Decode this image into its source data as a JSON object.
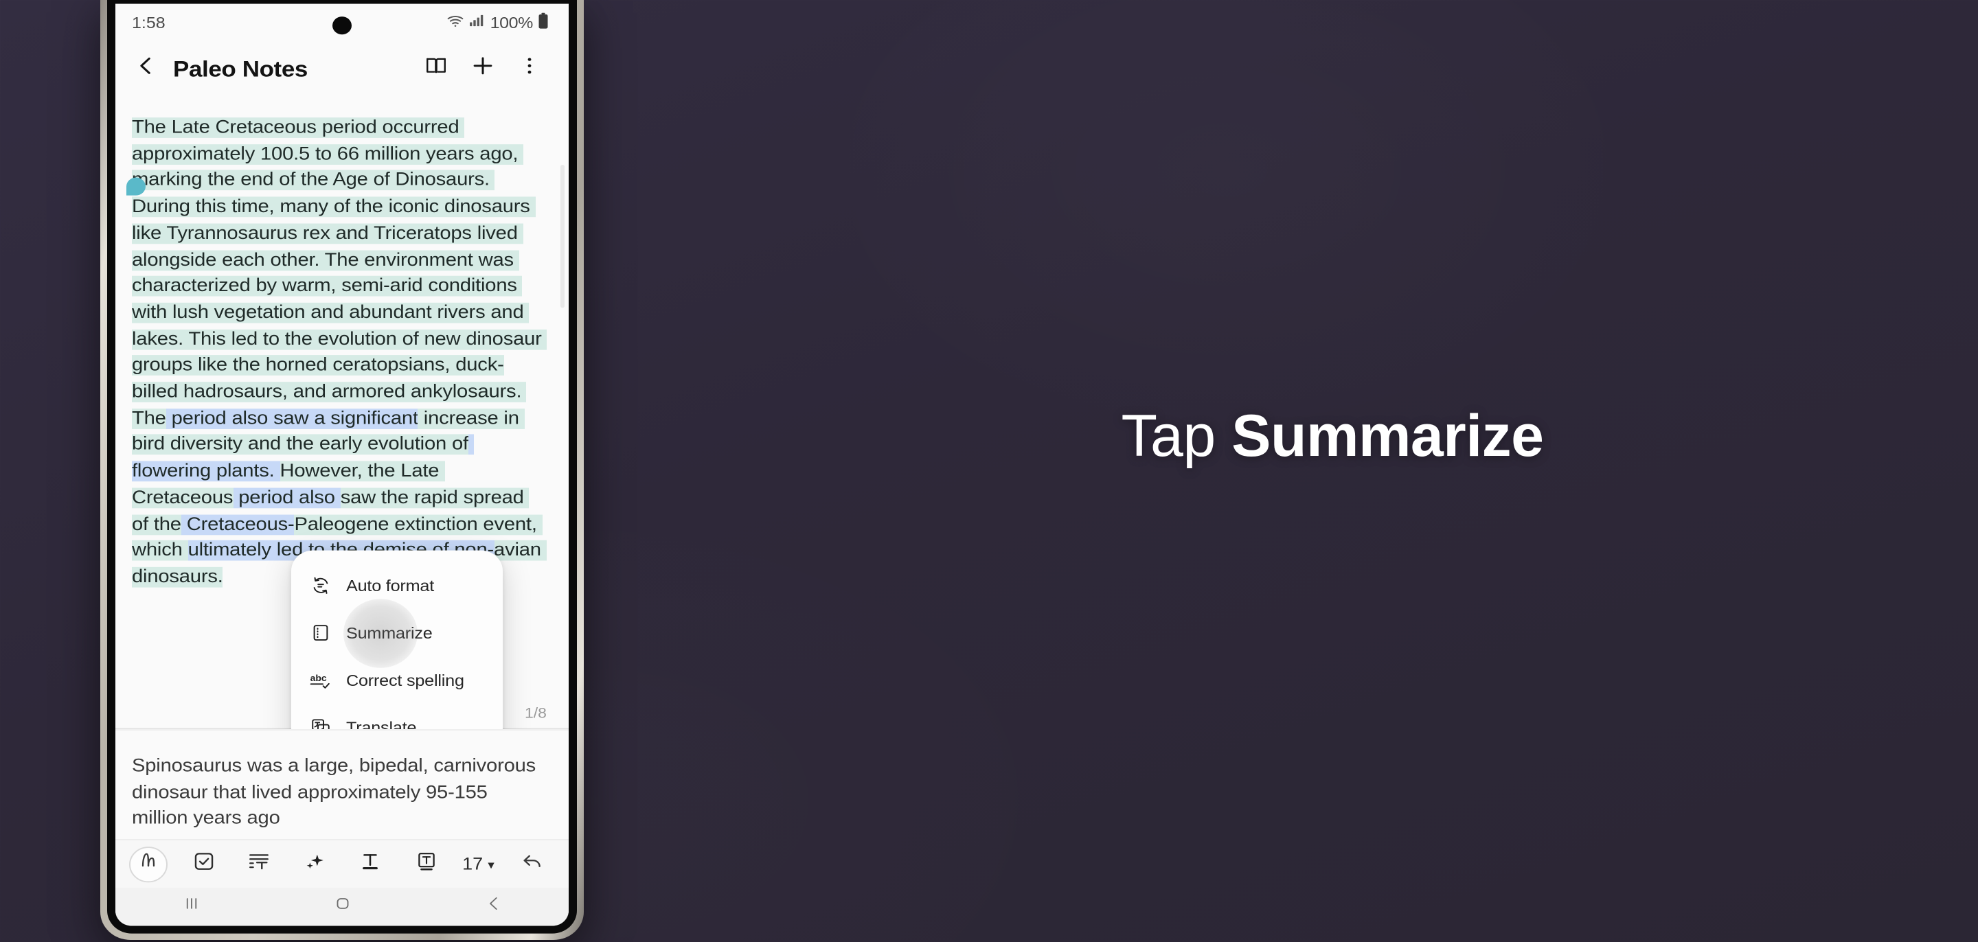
{
  "caption": {
    "light_text": "Tap ",
    "bold_text": "Summarize"
  },
  "colors": {
    "background": "#302a3d",
    "caption_text": "#ffffff",
    "mint_highlight": "#d6ebe5",
    "blue_highlight": "#c7d9f7",
    "handle_start": "#5ab9c9",
    "handle_end": "#3a87e8",
    "screen_background": "#fafafa"
  },
  "phone": {
    "status_bar": {
      "time": "1:58",
      "battery_percent": "100%",
      "icons": [
        "wifi-icon",
        "cellular-signal-icon",
        "battery-icon"
      ]
    },
    "app_bar": {
      "back_icon": "chevron-left-icon",
      "title": "Paleo Notes",
      "actions": [
        {
          "icon": "book-reading-mode-icon",
          "name": "reading-mode-button"
        },
        {
          "icon": "plus-add-icon",
          "name": "add-button"
        },
        {
          "icon": "overflow-menu-icon",
          "name": "more-options-button"
        }
      ]
    },
    "note": {
      "paragraph_segments": [
        {
          "text": "The Late Cretaceous period occurred approximately 100.5 to 66 million years ago, marking the end of the Age of Dinosaurs. During this time, many of the iconic dinosaurs like Tyrannosaurus rex and Triceratops lived alongside each other. The environment was characterized by warm, semi-arid conditions with lush vegetation and abundant rivers and lakes. This led to the evolution of new dinosaur groups like the horned ceratopsians, duck-billed hadrosaurs, and armored ankylosaurs. The",
          "highlight": "mint"
        },
        {
          "text": " period also saw a significant",
          "highlight": "blue"
        },
        {
          "text": " increase in bird diversity and the early evolution of",
          "highlight": "mint"
        },
        {
          "text": " flowering plants. ",
          "highlight": "blue"
        },
        {
          "text": "However, the Late Cretaceous",
          "highlight": "mint"
        },
        {
          "text": " period also ",
          "highlight": "blue"
        },
        {
          "text": "saw the rapid spread of the",
          "highlight": "mint"
        },
        {
          "text": " Cretaceous-",
          "highlight": "blue"
        },
        {
          "text": "Paleogene extinction event, which ",
          "highlight": "mint"
        },
        {
          "text": "ultimately led to the demise of non-",
          "highlight": "blue"
        },
        {
          "text": "avian dinosaurs.",
          "highlight": "mint"
        }
      ],
      "page_indicator": "1/8",
      "next_paragraph": "Spinosaurus was a large, bipedal, carnivorous dinosaur that lived approximately 95-155 million years ago"
    },
    "ai_menu": {
      "items": [
        {
          "label": "Auto format",
          "icon": "auto-format-icon",
          "pressed": false
        },
        {
          "label": "Summarize",
          "icon": "summarize-icon",
          "pressed": true
        },
        {
          "label": "Correct spelling",
          "icon": "spellcheck-abc-icon",
          "pressed": false
        },
        {
          "label": "Translate",
          "icon": "translate-icon",
          "pressed": false
        }
      ]
    },
    "format_toolbar": {
      "items": [
        {
          "name": "handwriting-pen-button",
          "icon": "pen-stroke-icon"
        },
        {
          "name": "checklist-button",
          "icon": "checkbox-icon"
        },
        {
          "name": "text-indent-button",
          "icon": "indent-text-icon"
        },
        {
          "name": "ai-assist-button",
          "icon": "sparkle-icon"
        },
        {
          "name": "text-style-button",
          "icon": "underlined-t-icon"
        },
        {
          "name": "text-box-button",
          "icon": "boxed-t-icon"
        }
      ],
      "font_size": "17",
      "caret_icon": "chevron-down-icon",
      "undo": {
        "name": "undo-button",
        "icon": "undo-arrow-icon"
      }
    },
    "nav_bar": {
      "recents": "recents-icon",
      "home": "home-icon",
      "back": "back-icon"
    }
  }
}
